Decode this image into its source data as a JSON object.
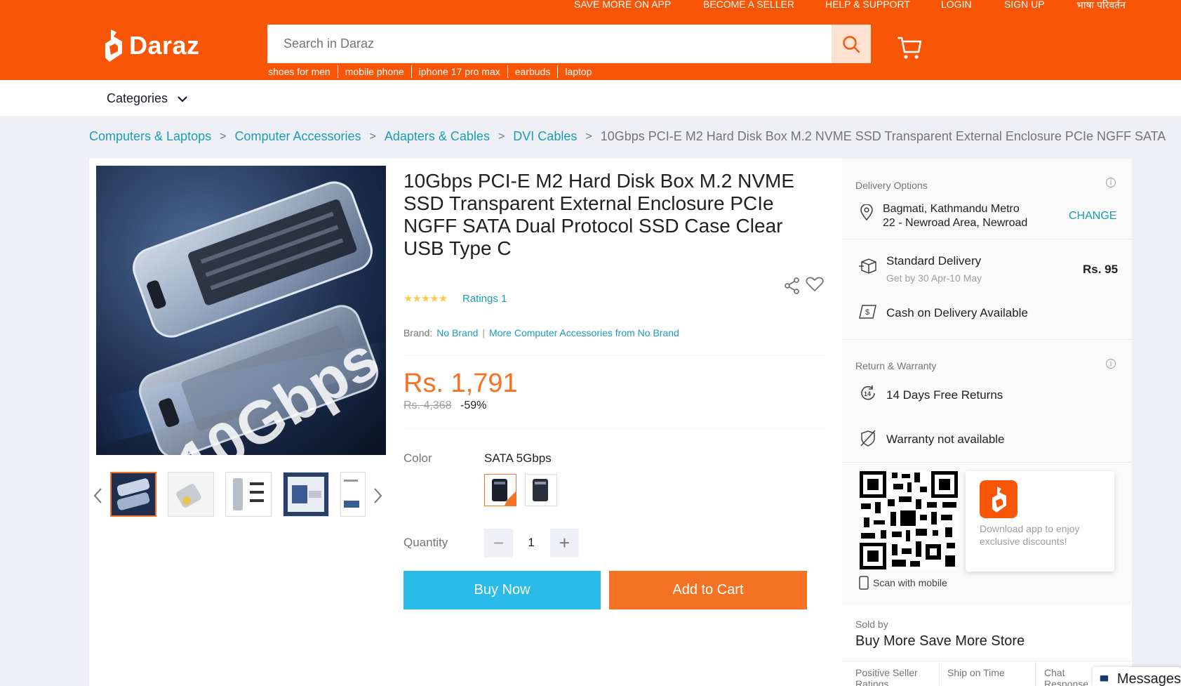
{
  "topbar": {
    "links": [
      "SAVE MORE ON APP",
      "BECOME A SELLER",
      "HELP & SUPPORT",
      "LOGIN",
      "SIGN UP",
      "भाषा परिवर्तन"
    ],
    "logo_text": "Daraz"
  },
  "search": {
    "placeholder": "Search in Daraz",
    "suggestions": [
      "shoes for men",
      "mobile phone",
      "iphone 17 pro max",
      "earbuds",
      "laptop"
    ]
  },
  "nav": {
    "categories_label": "Categories"
  },
  "breadcrumb": {
    "items": [
      "Computers & Laptops",
      "Computer Accessories",
      "Adapters & Cables",
      "DVI Cables"
    ],
    "current": "10Gbps PCI-E M2 Hard Disk Box M.2 NVME SSD Transparent External Enclosure PCIe NGFF SATA"
  },
  "product": {
    "image_text": "10Gbps",
    "title": "10Gbps PCI-E M2 Hard Disk Box M.2 NVME SSD Transparent External Enclosure PCIe NGFF SATA Dual Protocol SSD Case Clear USB Type C",
    "rating_stars": 5,
    "ratings_label": "Ratings 1",
    "brand_label": "Brand:",
    "brand": "No Brand",
    "more_from_brand": "More Computer Accessories from No Brand",
    "price": "Rs. 1,791",
    "original_price": "Rs. 4,368",
    "discount": "-59%",
    "color_label": "Color",
    "color_value": "SATA 5Gbps",
    "quantity_label": "Quantity",
    "quantity": "1",
    "minus": "−",
    "plus": "+",
    "buy_now": "Buy Now",
    "add_to_cart": "Add to Cart"
  },
  "delivery": {
    "title": "Delivery Options",
    "location_line1": "Bagmati, Kathmandu Metro",
    "location_line2": "22 - Newroad Area, Newroad",
    "change": "CHANGE",
    "standard": "Standard Delivery",
    "standard_eta": "Get by 30 Apr-10 May",
    "standard_price": "Rs. 95",
    "cod": "Cash on Delivery Available"
  },
  "warranty": {
    "title": "Return & Warranty",
    "returns": "14 Days Free Returns",
    "returns_icon_text": "14",
    "warranty": "Warranty not available"
  },
  "app": {
    "promo": "Download app to enjoy exclusive discounts!",
    "scan": "Scan with mobile"
  },
  "seller": {
    "sold_by": "Sold by",
    "name": "Buy More Save More Store",
    "metric1": "Positive Seller Ratings",
    "metric2": "Ship on Time",
    "metric3": "Chat Response Rate"
  },
  "chat": {
    "label": "Messages"
  },
  "colors": {
    "brand": "#f85606",
    "accent": "#f57224",
    "link": "#1a9cb7",
    "buy": "#2abbe8"
  }
}
